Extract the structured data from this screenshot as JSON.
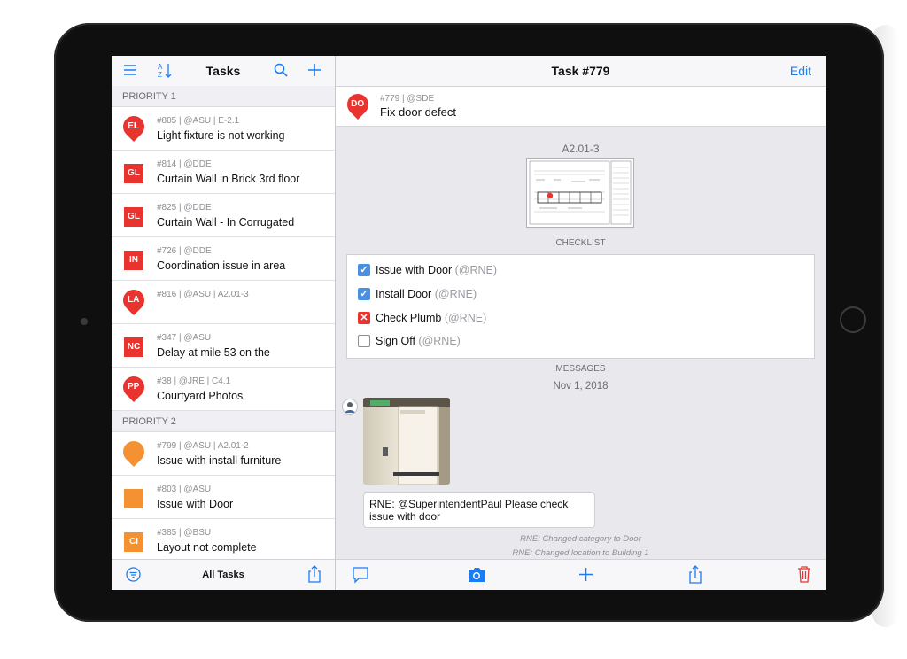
{
  "left": {
    "title": "Tasks",
    "footer_label": "All Tasks",
    "sections": [
      {
        "label": "PRIORITY 1",
        "items": [
          {
            "code": "EL",
            "shape": "pin",
            "color": "#e9332f",
            "meta": "#805 | @ASU | E-2.1",
            "name": "Light fixture is not working"
          },
          {
            "code": "GL",
            "shape": "square",
            "color": "#e9332f",
            "meta": "#814 | @DDE",
            "name": "Curtain Wall in Brick 3rd floor"
          },
          {
            "code": "GL",
            "shape": "square",
            "color": "#e9332f",
            "meta": "#825 | @DDE",
            "name": "Curtain Wall - In Corrugated"
          },
          {
            "code": "IN",
            "shape": "square",
            "color": "#e9332f",
            "meta": "#726 | @DDE",
            "name": "Coordination issue in area"
          },
          {
            "code": "LA",
            "shape": "pin",
            "color": "#e9332f",
            "meta": "#816 | @ASU | A2.01-3",
            "name": ""
          },
          {
            "code": "NC",
            "shape": "square",
            "color": "#e9332f",
            "meta": "#347 | @ASU",
            "name": "Delay at mile 53 on the"
          },
          {
            "code": "PP",
            "shape": "pin",
            "color": "#e9332f",
            "meta": "#38 | @JRE | C4.1",
            "name": "Courtyard Photos"
          }
        ]
      },
      {
        "label": "PRIORITY 2",
        "items": [
          {
            "code": "",
            "shape": "pin",
            "color": "#f39133",
            "meta": "#799 | @ASU | A2.01-2",
            "name": "Issue with install furniture"
          },
          {
            "code": "",
            "shape": "square",
            "color": "#f39133",
            "meta": "#803 | @ASU",
            "name": "Issue with Door"
          },
          {
            "code": "CI",
            "shape": "square",
            "color": "#f39133",
            "meta": "#385 | @BSU",
            "name": "Layout not complete"
          }
        ]
      }
    ]
  },
  "right": {
    "title": "Task #779",
    "edit_label": "Edit",
    "header": {
      "code": "DO",
      "color": "#e9332f",
      "meta": "#779 | @SDE",
      "name": "Fix door defect"
    },
    "sheet_label": "A2.01-3",
    "checklist_label": "CHECKLIST",
    "checklist": [
      {
        "label": "Issue with Door",
        "who": "(@RNE)",
        "state": "checked"
      },
      {
        "label": "Install Door",
        "who": "(@RNE)",
        "state": "checked"
      },
      {
        "label": "Check Plumb",
        "who": "(@RNE)",
        "state": "failed"
      },
      {
        "label": "Sign Off",
        "who": "(@RNE)",
        "state": "unchecked"
      }
    ],
    "messages_label": "MESSAGES",
    "date": "Nov 1, 2018",
    "message": "RNE: @SuperintendentPaul Please check issue with door",
    "log": [
      "RNE: Changed category to Door",
      "RNE: Changed location to Building 1"
    ]
  },
  "colors": {
    "accent": "#1a7cf4",
    "danger": "#e9332f",
    "warning": "#f39133",
    "checked": "#4a90e2"
  }
}
